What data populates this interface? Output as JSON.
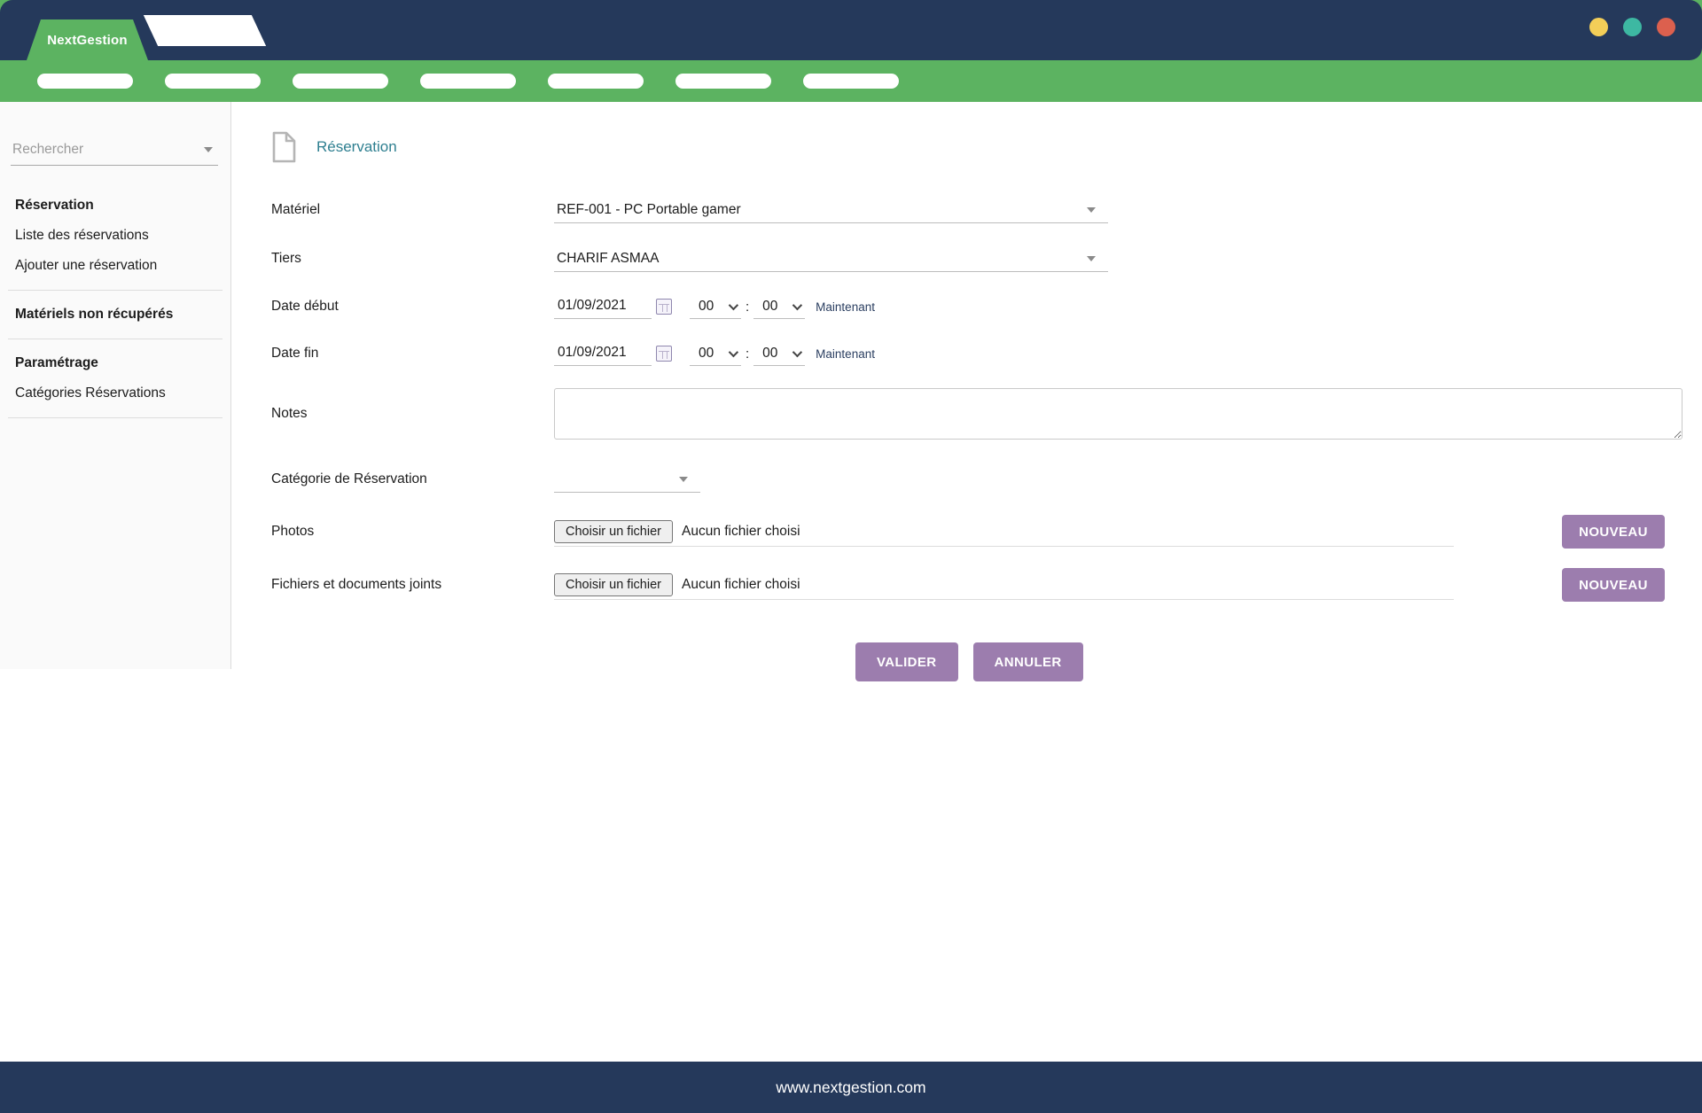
{
  "header": {
    "brand": "NextGestion"
  },
  "navbar": {
    "pill_count": 7
  },
  "sidebar": {
    "search_placeholder": "Rechercher",
    "items": [
      {
        "label": "Réservation",
        "bold": true
      },
      {
        "label": "Liste des réservations",
        "bold": false
      },
      {
        "label": "Ajouter une réservation",
        "bold": false
      },
      {
        "label": "Matériels non récupérés",
        "bold": true
      },
      {
        "label": "Paramétrage",
        "bold": true
      },
      {
        "label": "Catégories Réservations",
        "bold": false
      }
    ]
  },
  "page": {
    "title": "Réservation"
  },
  "form": {
    "time_separator": ":",
    "materiel": {
      "label": "Matériel",
      "value": "REF-001 - PC Portable gamer"
    },
    "tiers": {
      "label": "Tiers",
      "value": "CHARIF ASMAA"
    },
    "date_debut": {
      "label": "Date début",
      "date": "01/09/2021",
      "hour": "00",
      "minute": "00",
      "now": "Maintenant"
    },
    "date_fin": {
      "label": "Date fin",
      "date": "01/09/2021",
      "hour": "00",
      "minute": "00",
      "now": "Maintenant"
    },
    "notes": {
      "label": "Notes",
      "value": ""
    },
    "categorie": {
      "label": "Catégorie de Réservation",
      "value": ""
    },
    "photos": {
      "label": "Photos",
      "choose_button": "Choisir un fichier",
      "no_file": "Aucun fichier choisi",
      "new_button": "NOUVEAU"
    },
    "fichiers": {
      "label": "Fichiers et documents joints",
      "choose_button": "Choisir un fichier",
      "no_file": "Aucun fichier choisi",
      "new_button": "NOUVEAU"
    },
    "actions": {
      "submit": "VALIDER",
      "cancel": "ANNULER"
    }
  },
  "footer": {
    "url": "www.nextgestion.com"
  },
  "icons": {
    "caret-down-icon": "css-triangle",
    "chevron-down-icon": "css-chevron",
    "calendar-icon": "css-grid-square",
    "document-icon": "svg-file-outline"
  },
  "colors": {
    "header_navy": "#25395B",
    "nav_green": "#5CB361",
    "button_purple": "#9C7DAE",
    "title_teal": "#2E7F90",
    "dot_yellow": "#F3CE58",
    "dot_teal": "#3DB8A2",
    "dot_red": "#DC604E"
  }
}
